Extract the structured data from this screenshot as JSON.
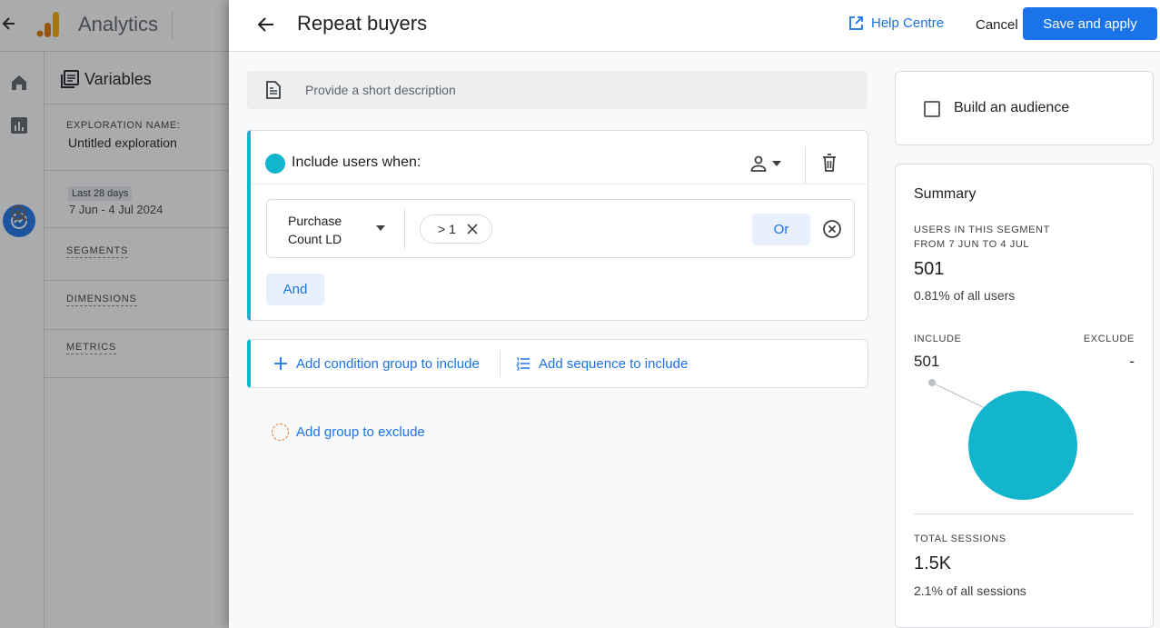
{
  "background": {
    "app_name": "Analytics",
    "panel_title": "Variables",
    "exploration_label": "EXPLORATION NAME:",
    "exploration_name": "Untitled exploration",
    "date_chip": "Last 28 days",
    "date_range": "7 Jun - 4 Jul 2024",
    "sections": [
      "SEGMENTS",
      "DIMENSIONS",
      "METRICS"
    ]
  },
  "dialog": {
    "title": "Repeat buyers",
    "help_label": "Help Centre",
    "cancel_label": "Cancel",
    "save_label": "Save and apply",
    "description_placeholder": "Provide a short description",
    "include_title": "Include users when:",
    "condition": {
      "dimension": "Purchase Count LD",
      "chip_label": "> 1"
    },
    "or_label": "Or",
    "and_label": "And",
    "add_condition_group": "Add condition group to include",
    "add_sequence": "Add sequence to include",
    "add_exclude": "Add group to exclude"
  },
  "audience": {
    "label": "Build an audience"
  },
  "summary": {
    "title": "Summary",
    "users_label_line1": "USERS IN THIS SEGMENT",
    "users_label_line2": "FROM 7 JUN TO 4 JUL",
    "users_value": "501",
    "users_pct": "0.81% of all users",
    "include_label": "INCLUDE",
    "exclude_label": "EXCLUDE",
    "include_value": "501",
    "exclude_value": "-",
    "sessions_label": "TOTAL SESSIONS",
    "sessions_value": "1.5K",
    "sessions_pct": "2.1% of all sessions"
  },
  "colors": {
    "accent": "#1a73e8",
    "segment": "#12b5cb",
    "exclude": "#e8710a"
  }
}
